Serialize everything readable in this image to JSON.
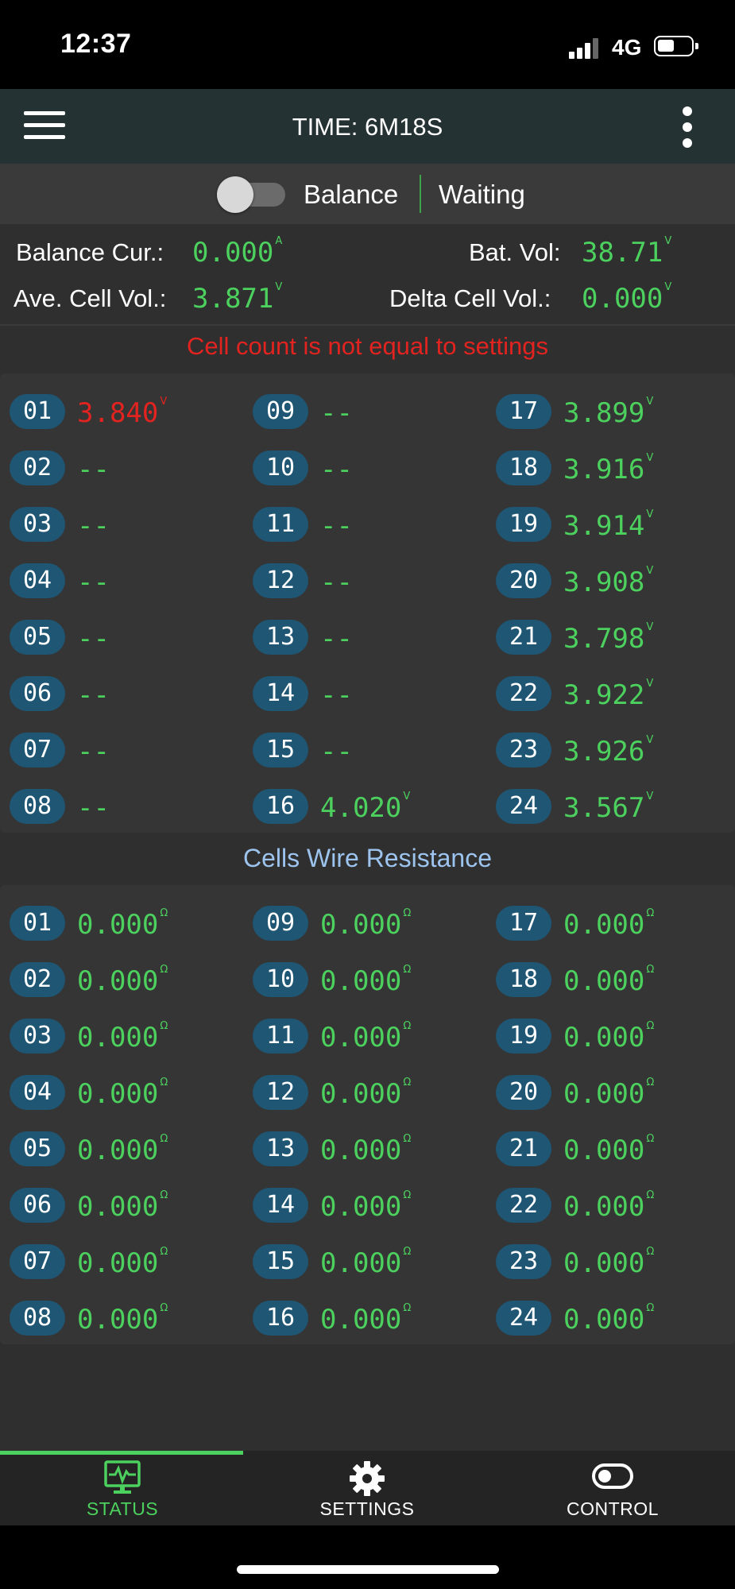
{
  "status_bar": {
    "time": "12:37",
    "network": "4G"
  },
  "header": {
    "title": "TIME: 6M18S"
  },
  "balance": {
    "label": "Balance",
    "state": "Waiting",
    "enabled": false
  },
  "info": {
    "balance_current": {
      "label": "Balance Cur.:",
      "value": "0.000",
      "unit": "A"
    },
    "battery_voltage": {
      "label": "Bat. Vol:",
      "value": "38.71",
      "unit": "V"
    },
    "average_cell_voltage": {
      "label": "Ave. Cell Vol.:",
      "value": "3.871",
      "unit": "V"
    },
    "delta_cell_voltage": {
      "label": "Delta Cell Vol.:",
      "value": "0.000",
      "unit": "V"
    }
  },
  "warning": "Cell count is not equal to settings",
  "cell_voltages": [
    {
      "id": "01",
      "value": "3.840",
      "unit": "V",
      "alert": true
    },
    {
      "id": "02",
      "value": "--",
      "unit": ""
    },
    {
      "id": "03",
      "value": "--",
      "unit": ""
    },
    {
      "id": "04",
      "value": "--",
      "unit": ""
    },
    {
      "id": "05",
      "value": "--",
      "unit": ""
    },
    {
      "id": "06",
      "value": "--",
      "unit": ""
    },
    {
      "id": "07",
      "value": "--",
      "unit": ""
    },
    {
      "id": "08",
      "value": "--",
      "unit": ""
    },
    {
      "id": "09",
      "value": "--",
      "unit": ""
    },
    {
      "id": "10",
      "value": "--",
      "unit": ""
    },
    {
      "id": "11",
      "value": "--",
      "unit": ""
    },
    {
      "id": "12",
      "value": "--",
      "unit": ""
    },
    {
      "id": "13",
      "value": "--",
      "unit": ""
    },
    {
      "id": "14",
      "value": "--",
      "unit": ""
    },
    {
      "id": "15",
      "value": "--",
      "unit": ""
    },
    {
      "id": "16",
      "value": "4.020",
      "unit": "V"
    },
    {
      "id": "17",
      "value": "3.899",
      "unit": "V"
    },
    {
      "id": "18",
      "value": "3.916",
      "unit": "V"
    },
    {
      "id": "19",
      "value": "3.914",
      "unit": "V"
    },
    {
      "id": "20",
      "value": "3.908",
      "unit": "V"
    },
    {
      "id": "21",
      "value": "3.798",
      "unit": "V"
    },
    {
      "id": "22",
      "value": "3.922",
      "unit": "V"
    },
    {
      "id": "23",
      "value": "3.926",
      "unit": "V"
    },
    {
      "id": "24",
      "value": "3.567",
      "unit": "V"
    }
  ],
  "wire_resistance": {
    "title": "Cells Wire Resistance",
    "cells": [
      {
        "id": "01",
        "value": "0.000",
        "unit": "Ω"
      },
      {
        "id": "02",
        "value": "0.000",
        "unit": "Ω"
      },
      {
        "id": "03",
        "value": "0.000",
        "unit": "Ω"
      },
      {
        "id": "04",
        "value": "0.000",
        "unit": "Ω"
      },
      {
        "id": "05",
        "value": "0.000",
        "unit": "Ω"
      },
      {
        "id": "06",
        "value": "0.000",
        "unit": "Ω"
      },
      {
        "id": "07",
        "value": "0.000",
        "unit": "Ω"
      },
      {
        "id": "08",
        "value": "0.000",
        "unit": "Ω"
      },
      {
        "id": "09",
        "value": "0.000",
        "unit": "Ω"
      },
      {
        "id": "10",
        "value": "0.000",
        "unit": "Ω"
      },
      {
        "id": "11",
        "value": "0.000",
        "unit": "Ω"
      },
      {
        "id": "12",
        "value": "0.000",
        "unit": "Ω"
      },
      {
        "id": "13",
        "value": "0.000",
        "unit": "Ω"
      },
      {
        "id": "14",
        "value": "0.000",
        "unit": "Ω"
      },
      {
        "id": "15",
        "value": "0.000",
        "unit": "Ω"
      },
      {
        "id": "16",
        "value": "0.000",
        "unit": "Ω"
      },
      {
        "id": "17",
        "value": "0.000",
        "unit": "Ω"
      },
      {
        "id": "18",
        "value": "0.000",
        "unit": "Ω"
      },
      {
        "id": "19",
        "value": "0.000",
        "unit": "Ω"
      },
      {
        "id": "20",
        "value": "0.000",
        "unit": "Ω"
      },
      {
        "id": "21",
        "value": "0.000",
        "unit": "Ω"
      },
      {
        "id": "22",
        "value": "0.000",
        "unit": "Ω"
      },
      {
        "id": "23",
        "value": "0.000",
        "unit": "Ω"
      },
      {
        "id": "24",
        "value": "0.000",
        "unit": "Ω"
      }
    ]
  },
  "tabs": [
    {
      "label": "STATUS",
      "icon": "monitor-pulse-icon",
      "active": true
    },
    {
      "label": "SETTINGS",
      "icon": "gear-icon",
      "active": false
    },
    {
      "label": "CONTROL",
      "icon": "toggle-icon",
      "active": false
    }
  ],
  "colors": {
    "value_green": "#4cd15e",
    "alert_red": "#e2231f",
    "badge_blue": "#1e5674",
    "section_blue": "#9dc4ef",
    "header_bg": "#253233"
  }
}
